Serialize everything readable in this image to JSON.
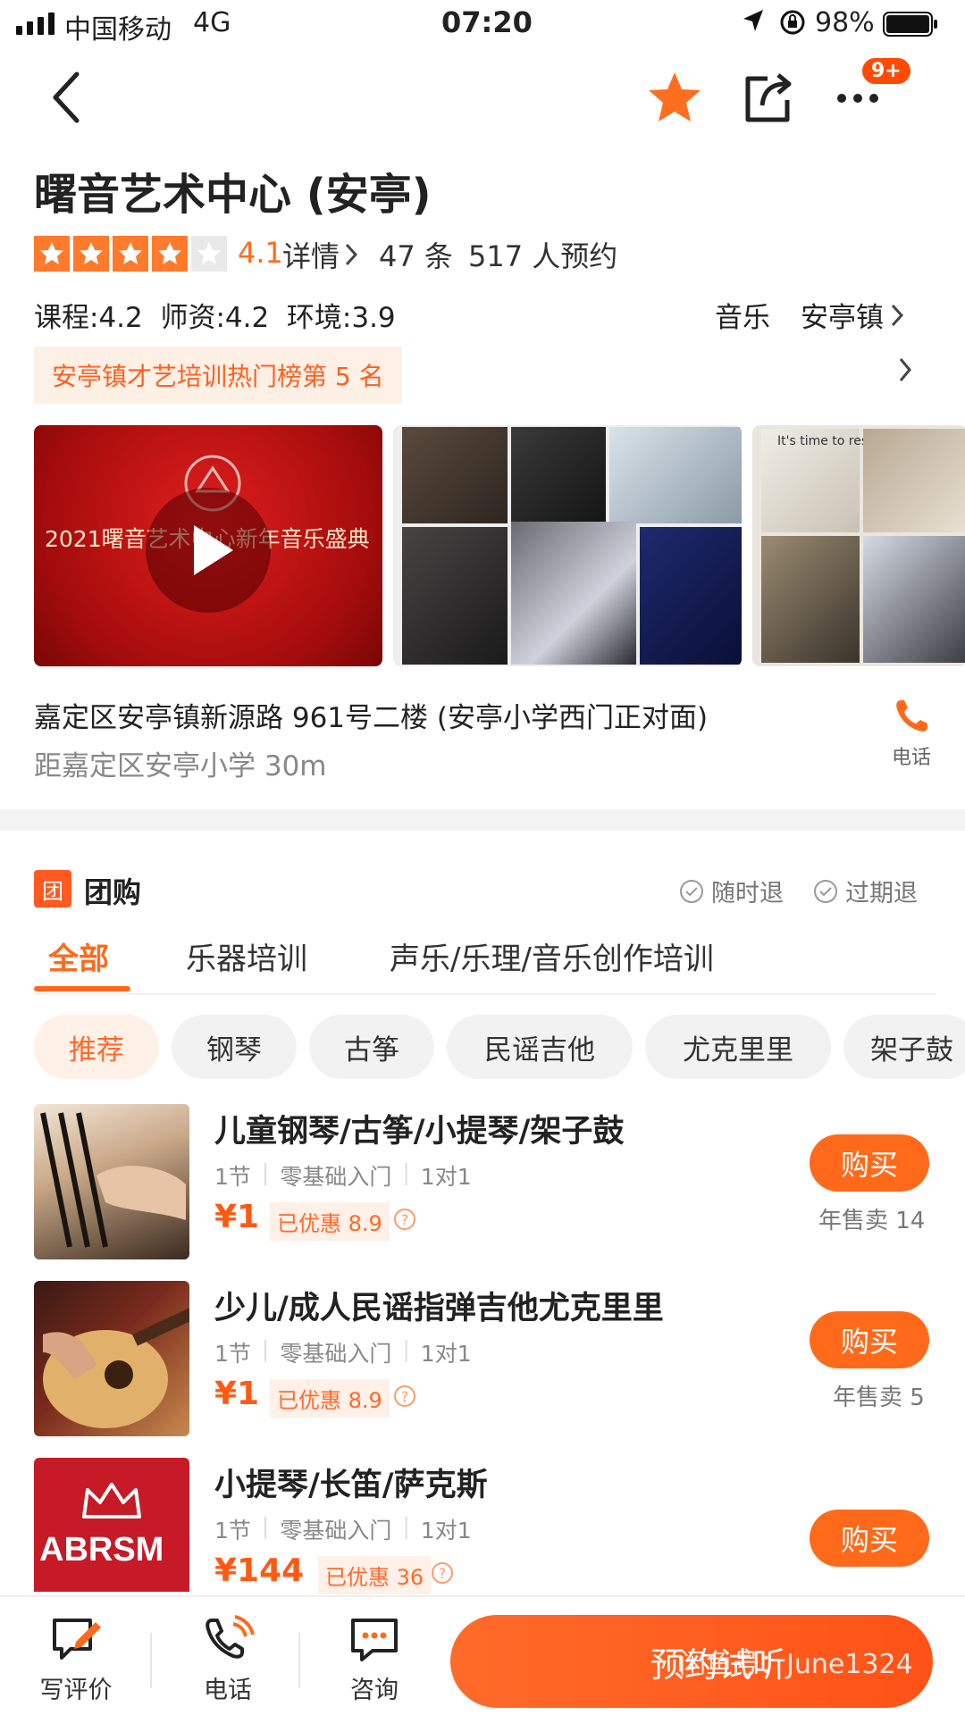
{
  "status_bar": {
    "carrier": "中国移动",
    "network": "4G",
    "time": "07:20",
    "battery": "98%"
  },
  "header": {
    "badge": "9+"
  },
  "shop": {
    "name": "曙音艺术中心 (安亭)",
    "rating": "4.1",
    "stars_filled": 4,
    "details_link": "详情",
    "review_count": "47 条",
    "booking_count": "517 人预约",
    "scores": "课程:4.2  师资:4.2  环境:3.9",
    "category": "音乐",
    "town": "安亭镇",
    "rank_tag": "安亭镇才艺培训热门榜第 5 名",
    "address": "嘉定区安亭镇新源路 961号二楼 (安亭小学西门正对面)",
    "distance": "距嘉定区安亭小学 30m",
    "phone_label": "电话"
  },
  "gallery": {
    "video_caption": "2021曙音艺术中心新年音乐盛典",
    "photo3_text": "It's time to rest"
  },
  "group_buy": {
    "icon_text": "团",
    "title": "团购",
    "anytime_refund": "随时退",
    "expiry_refund": "过期退",
    "tabs": [
      "全部",
      "乐器培训",
      "声乐/乐理/音乐创作培训"
    ],
    "filters": [
      "推荐",
      "钢琴",
      "古筝",
      "民谣吉他",
      "尤克里里",
      "架子鼓"
    ],
    "deals": [
      {
        "title": "儿童钢琴/古筝/小提琴/架子鼓",
        "lessons": "1节",
        "level": "零基础入门",
        "mode": "1对1",
        "price": "¥1",
        "discount": "已优惠 8.9",
        "buy": "购买",
        "sold": "年售卖 14"
      },
      {
        "title": "少儿/成人民谣指弹吉他尤克里里",
        "lessons": "1节",
        "level": "零基础入门",
        "mode": "1对1",
        "price": "¥1",
        "discount": "已优惠 8.9",
        "buy": "购买",
        "sold": "年售卖 5"
      },
      {
        "title": "小提琴/长笛/萨克斯",
        "lessons": "1节",
        "level": "零基础入门",
        "mode": "1对1",
        "price": "¥144",
        "discount": "已优惠 36",
        "buy": "购买",
        "sold": "",
        "thumb_text": "ABRSM"
      }
    ]
  },
  "bottom_bar": {
    "review": "写评价",
    "phone": "电话",
    "consult": "咨询",
    "cta": "预约试听",
    "watermark": "闲鱼号：June1324"
  }
}
